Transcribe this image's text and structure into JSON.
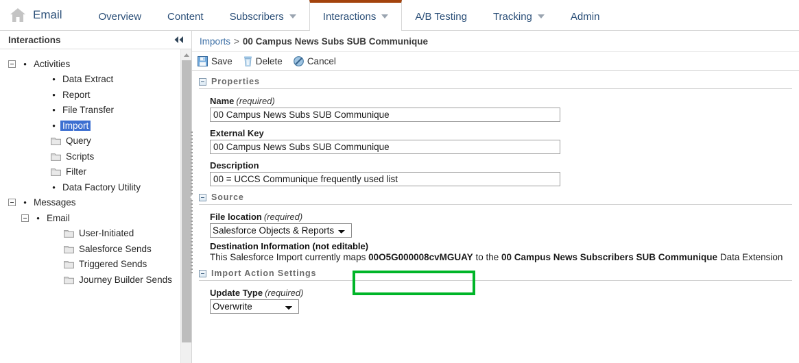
{
  "topnav": {
    "home_icon": "home-icon",
    "brand": "Email",
    "items": [
      {
        "label": "Overview",
        "caret": false,
        "active": false
      },
      {
        "label": "Content",
        "caret": false,
        "active": false
      },
      {
        "label": "Subscribers",
        "caret": true,
        "active": false
      },
      {
        "label": "Interactions",
        "caret": true,
        "active": true
      },
      {
        "label": "A/B Testing",
        "caret": false,
        "active": false
      },
      {
        "label": "Tracking",
        "caret": true,
        "active": false
      },
      {
        "label": "Admin",
        "caret": false,
        "active": false
      }
    ],
    "active_tab_accent": "#a3430c",
    "link_color": "#2b4f78"
  },
  "sidebar": {
    "title": "Interactions",
    "collapse_icon": "collapse-left-double-chevron-icon",
    "scroll_up_icon": "scroll-up-arrow-icon",
    "selection_color": "#3c6fd1",
    "tree": [
      {
        "label": "Activities",
        "level": 0,
        "twisty": "minus",
        "icon": "bullet",
        "selected": false
      },
      {
        "label": "Data Extract",
        "level": 1,
        "twisty": "none",
        "icon": "bullet",
        "selected": false
      },
      {
        "label": "Report",
        "level": 1,
        "twisty": "none",
        "icon": "bullet",
        "selected": false
      },
      {
        "label": "File Transfer",
        "level": 1,
        "twisty": "none",
        "icon": "bullet",
        "selected": false
      },
      {
        "label": "Import",
        "level": 1,
        "twisty": "none",
        "icon": "bullet",
        "selected": true
      },
      {
        "label": "Query",
        "level": 1,
        "twisty": "none",
        "icon": "folder",
        "selected": false
      },
      {
        "label": "Scripts",
        "level": 1,
        "twisty": "none",
        "icon": "folder",
        "selected": false
      },
      {
        "label": "Filter",
        "level": 1,
        "twisty": "none",
        "icon": "folder",
        "selected": false
      },
      {
        "label": "Data Factory Utility",
        "level": 1,
        "twisty": "none",
        "icon": "bullet",
        "selected": false
      },
      {
        "label": "Messages",
        "level": 0,
        "twisty": "minus",
        "icon": "bullet",
        "selected": false
      },
      {
        "label": "Email",
        "level": 2,
        "twisty": "minus",
        "icon": "bullet",
        "selected": false
      },
      {
        "label": "User-Initiated",
        "level": 3,
        "twisty": "none",
        "icon": "folder",
        "selected": false
      },
      {
        "label": "Salesforce Sends",
        "level": 3,
        "twisty": "none",
        "icon": "folder",
        "selected": false
      },
      {
        "label": "Triggered Sends",
        "level": 3,
        "twisty": "none",
        "icon": "folder",
        "selected": false
      },
      {
        "label": "Journey Builder Sends",
        "level": 3,
        "twisty": "none",
        "icon": "folder",
        "selected": false
      }
    ]
  },
  "breadcrumb": {
    "root": "Imports",
    "separator": ">",
    "current": "00 Campus News Subs SUB Communique"
  },
  "toolbar": {
    "save_label": "Save",
    "save_icon": "save-disk-icon",
    "delete_label": "Delete",
    "delete_icon": "trash-icon",
    "cancel_label": "Cancel",
    "cancel_icon": "cancel-slash-circle-icon"
  },
  "properties": {
    "section_title": "Properties",
    "name_label": "Name",
    "name_required": "(required)",
    "name_value": "00 Campus News Subs SUB Communique",
    "name_placeholder": "",
    "external_key_label": "External Key",
    "external_key_value": "00 Campus News Subs SUB Communique",
    "external_key_placeholder": "",
    "description_label": "Description",
    "description_value": "00 = UCCS Communique frequently used list",
    "description_placeholder": ""
  },
  "source": {
    "section_title": "Source",
    "file_location_label": "File location",
    "file_location_required": "(required)",
    "file_location_value": "Salesforce Objects & Reports",
    "file_location_options": [
      "Salesforce Objects & Reports"
    ],
    "destination_label": "Destination Information (not editable)",
    "dest_prefix": "This Salesforce Import currently maps ",
    "dest_id": "00O5G000008cvMGUAY",
    "dest_middle": " to the ",
    "dest_target": "00 Campus News Subscribers SUB Communique",
    "dest_suffix": " Data Extension"
  },
  "import_action": {
    "section_title": "Import Action Settings",
    "update_type_label": "Update Type",
    "update_type_required": "(required)",
    "update_type_value": "Overwrite",
    "update_type_options": [
      "Overwrite"
    ]
  },
  "annotation": {
    "color": "#00b528",
    "target": "00O5G000008cvMGUAY"
  }
}
